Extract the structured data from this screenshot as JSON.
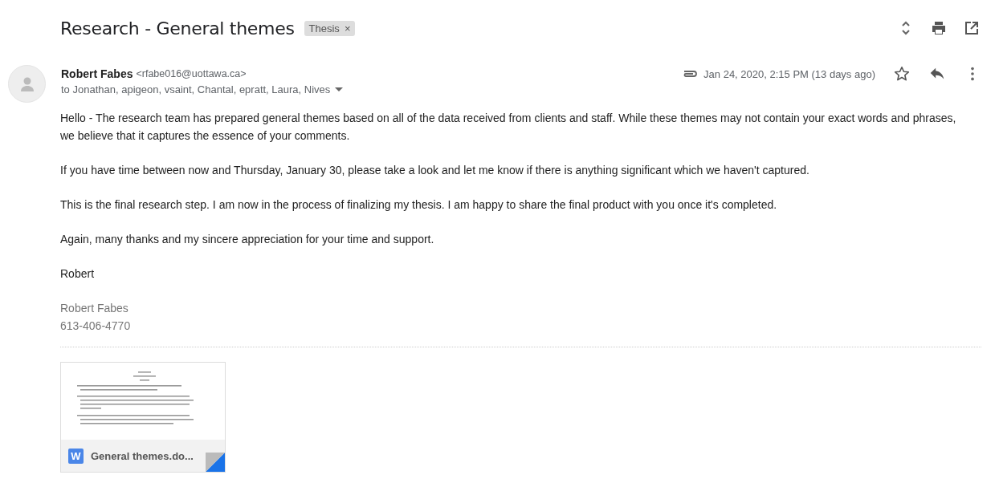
{
  "subject": "Research - General themes",
  "label": {
    "text": "Thesis",
    "remove": "×"
  },
  "sender": {
    "name": "Robert Fabes",
    "email": "<rfabe016@uottawa.ca>",
    "recipients": "to Jonathan, apigeon, vsaint, Chantal, epratt, Laura, Nives",
    "date": "Jan 24, 2020, 2:15 PM (13 days ago)",
    "has_attachment": true,
    "starred": false
  },
  "body": [
    "Hello - The research team has prepared general themes based on all of the data received from clients and staff. While these themes may not contain your exact words and phrases, we believe that it captures the essence of your comments.",
    "If you have time between now and Thursday, January 30, please take a look and let me know if there is anything significant which we haven't captured.",
    "This is the final research step. I am now in the process of finalizing my thesis. I am happy to share the final product with you once it's completed.",
    "Again, many thanks and my sincere appreciation for your time and support.",
    "Robert"
  ],
  "signature": [
    "Robert Fabes",
    "613-406-4770"
  ],
  "attachments": [
    {
      "badge": "W",
      "name": "General themes.do..."
    }
  ]
}
